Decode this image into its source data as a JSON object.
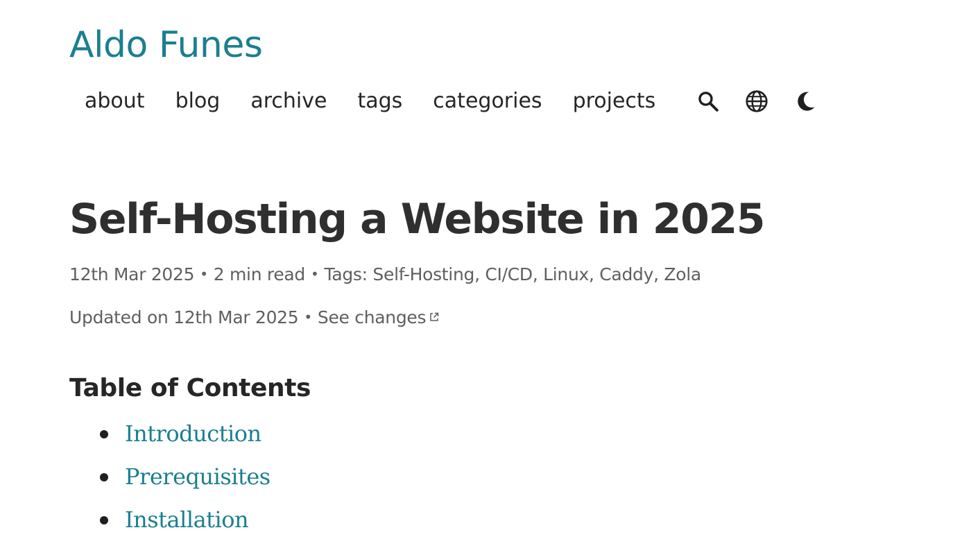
{
  "site": {
    "title": "Aldo Funes"
  },
  "nav": {
    "items": [
      {
        "label": "about"
      },
      {
        "label": "blog"
      },
      {
        "label": "archive"
      },
      {
        "label": "tags"
      },
      {
        "label": "categories"
      },
      {
        "label": "projects"
      }
    ],
    "icons": [
      "search-icon",
      "globe-icon",
      "moon-icon"
    ]
  },
  "post": {
    "title": "Self-Hosting a Website in 2025",
    "date": "12th Mar 2025",
    "separator": "•",
    "read_time": "2 min read",
    "tags_label": "Tags: ",
    "tags": [
      "Self-Hosting",
      "CI/CD",
      "Linux",
      "Caddy",
      "Zola"
    ],
    "tag_separator": ", ",
    "updated_text": "Updated on 12th Mar 2025",
    "changes_label": "See changes"
  },
  "toc": {
    "heading": "Table of Contents",
    "items": [
      {
        "label": "Introduction"
      },
      {
        "label": "Prerequisites"
      },
      {
        "label": "Installation"
      }
    ]
  },
  "colors": {
    "accent": "#1a7f8f",
    "text": "#2f2f2f",
    "muted": "#5f5f5f",
    "background": "#ffffff"
  }
}
